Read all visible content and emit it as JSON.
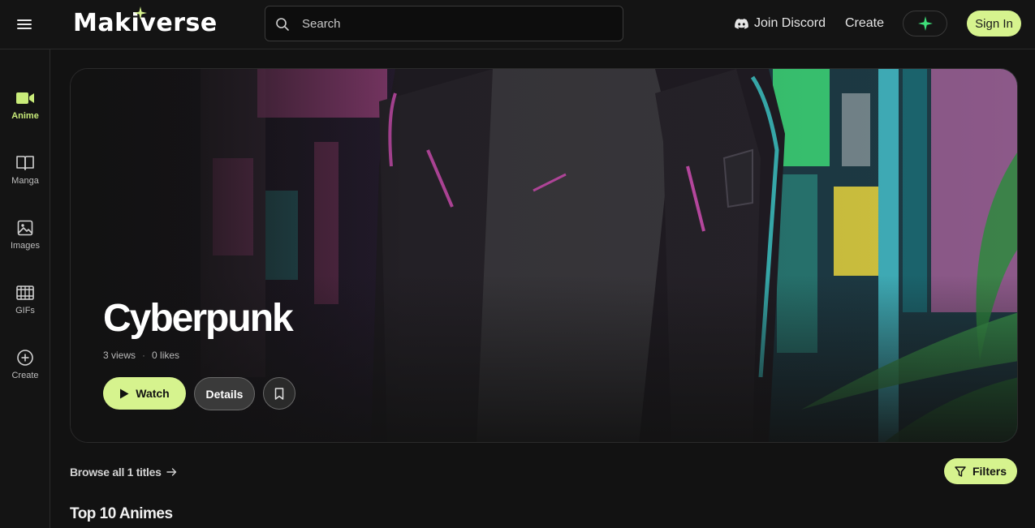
{
  "header": {
    "logo_text": "Makiverse",
    "search_placeholder": "Search",
    "discord_label": "Join Discord",
    "create_label": "Create",
    "signin_label": "Sign In",
    "accent_color": "#d6f38e"
  },
  "sidebar": {
    "items": [
      {
        "label": "Anime",
        "icon": "video-camera-icon",
        "active": true
      },
      {
        "label": "Manga",
        "icon": "open-book-icon",
        "active": false
      },
      {
        "label": "Images",
        "icon": "image-icon",
        "active": false
      },
      {
        "label": "GIFs",
        "icon": "film-icon",
        "active": false
      },
      {
        "label": "Create",
        "icon": "plus-circle-icon",
        "active": false
      }
    ]
  },
  "hero": {
    "title": "Cyberpunk",
    "views": "3 views",
    "separator": "·",
    "likes": "0 likes",
    "watch_label": "Watch",
    "details_label": "Details"
  },
  "browse": {
    "label": "Browse all 1 titles",
    "filters_label": "Filters"
  },
  "section": {
    "title": "Top 10 Animes"
  }
}
